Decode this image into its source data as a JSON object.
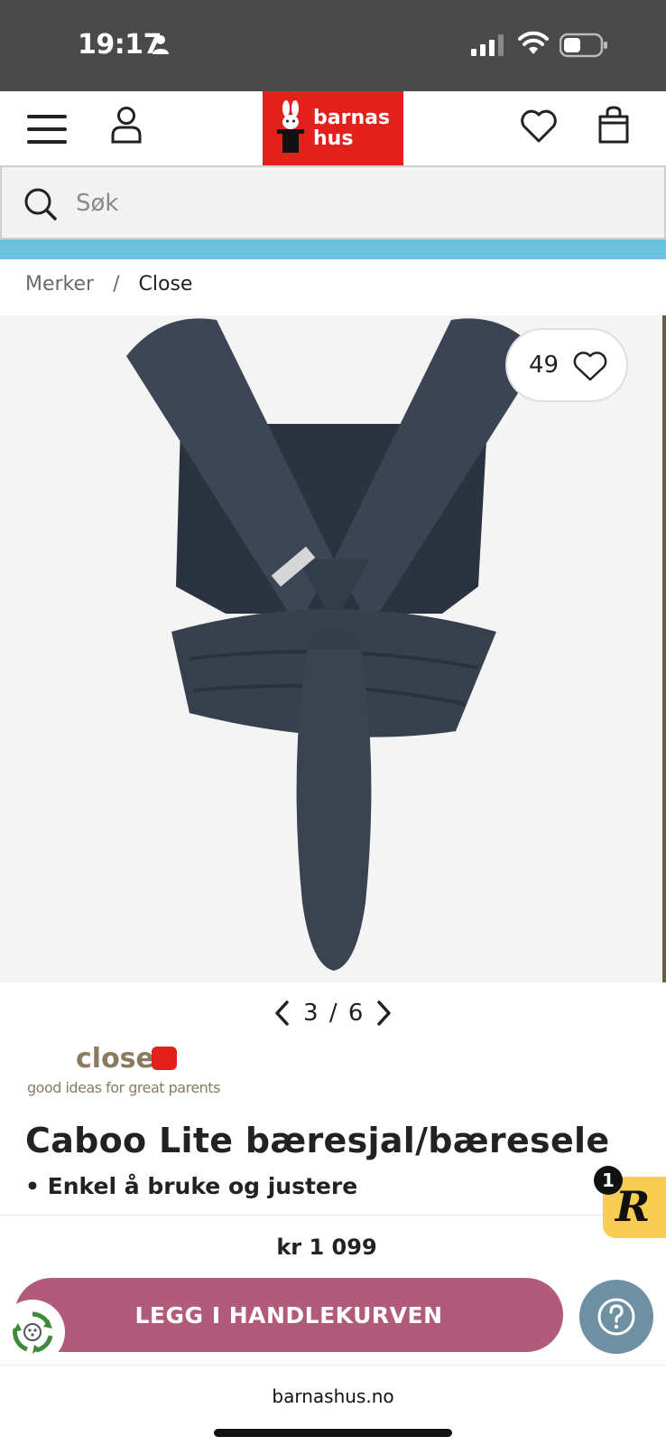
{
  "status_bar": {
    "time": "19:17",
    "signal_icon": "cellular-signal-icon",
    "wifi_icon": "wifi-icon",
    "battery_icon": "battery-icon"
  },
  "header": {
    "menu_icon": "hamburger-menu-icon",
    "account_icon": "account-icon",
    "logo_line1": "barnas",
    "logo_line2": "hus",
    "wishlist_icon": "heart-icon",
    "cart_icon": "shopping-bag-icon",
    "brand_color": "#e2211c"
  },
  "search": {
    "placeholder": "Søk",
    "value": ""
  },
  "promo": {
    "color": "#6cc1df"
  },
  "breadcrumb": {
    "items": [
      "Merker",
      "Close"
    ],
    "separator": "/"
  },
  "gallery": {
    "like_count": "49",
    "current": "3",
    "separator": "/",
    "total": "6"
  },
  "brand": {
    "name": "close",
    "tagline": "good ideas for great parents"
  },
  "product": {
    "title": "Caboo Lite bæresjal/bæresele",
    "bullet": "• Enkel å bruke og justere",
    "price": "kr 1 099"
  },
  "cta": {
    "add_to_cart": "LEGG I HANDLEKURVEN",
    "button_color": "#b25a7a"
  },
  "reviews_badge": {
    "letter": "R",
    "count": "1"
  },
  "browser": {
    "url": "barnashus.no"
  }
}
